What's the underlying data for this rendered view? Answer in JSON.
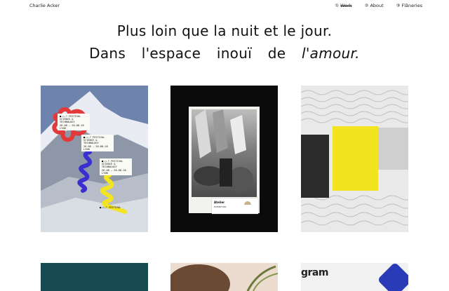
{
  "header": {
    "brand": "Charlie Acker",
    "nav": [
      {
        "num": "①",
        "label": "Work",
        "active": true
      },
      {
        "num": "②",
        "label": "About",
        "active": false
      },
      {
        "num": "③",
        "label": "Flâneries",
        "active": false
      }
    ]
  },
  "headline": {
    "line1": "Plus loin que la nuit et le jour.",
    "line2_prefix": "Dans l'espace inouï de ",
    "line2_emphasis": "l'amour."
  },
  "poster1": {
    "label_lines": [
      "■-○-? FESTIVAL",
      "SCIENCE & TECHNOLOGY",
      "26.08 — 28.08.18",
      "LYON"
    ],
    "footer": "■-○-? FESTIVAL"
  },
  "poster2": {
    "label_title": "Atelier",
    "label_sub": "EXHIBITION"
  },
  "poster6": {
    "text": "gram"
  },
  "colors": {
    "yellow": "#f2e41e",
    "dark_teal": "#164a52",
    "blue": "#2a3bb8",
    "red": "#e23a3a",
    "violet": "#3b2fd0"
  }
}
